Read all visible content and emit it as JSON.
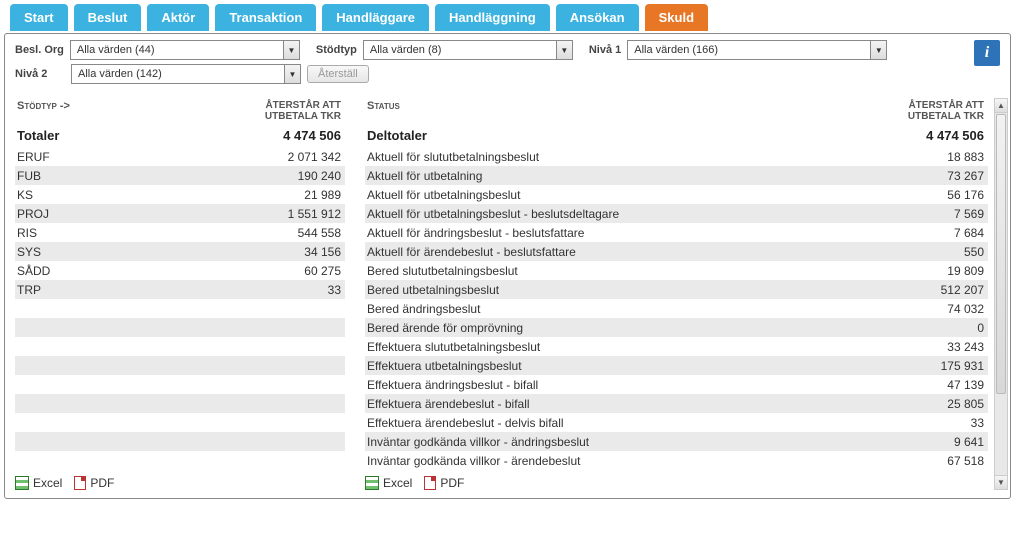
{
  "tabs": [
    "Start",
    "Beslut",
    "Aktör",
    "Transaktion",
    "Handläggare",
    "Handläggning",
    "Ansökan",
    "Skuld"
  ],
  "activeTab": "Skuld",
  "filters": {
    "beslOrgLabel": "Besl. Org",
    "beslOrgValue": "Alla värden (44)",
    "stodtypLabel": "Stödtyp",
    "stodtypValue": "Alla värden (8)",
    "niva1Label": "Nivå 1",
    "niva1Value": "Alla värden (166)",
    "niva2Label": "Nivå 2",
    "niva2Value": "Alla värden (142)",
    "resetLabel": "Återställ"
  },
  "left": {
    "header1": "Stödtyp ->",
    "header2a": "Återstår att",
    "header2b": "utbetala tkr",
    "totalLabel": "Totaler",
    "totalValue": "4 474 506",
    "rows": [
      {
        "label": "ERUF",
        "value": "2 071 342"
      },
      {
        "label": "FUB",
        "value": "190 240"
      },
      {
        "label": "KS",
        "value": "21 989"
      },
      {
        "label": "PROJ",
        "value": "1 551 912"
      },
      {
        "label": "RIS",
        "value": "544 558"
      },
      {
        "label": "SYS",
        "value": "34 156"
      },
      {
        "label": "SÅDD",
        "value": "60 275"
      },
      {
        "label": "TRP",
        "value": "33"
      },
      {
        "label": "",
        "value": ""
      },
      {
        "label": "",
        "value": ""
      },
      {
        "label": "",
        "value": ""
      },
      {
        "label": "",
        "value": ""
      },
      {
        "label": "",
        "value": ""
      },
      {
        "label": "",
        "value": ""
      },
      {
        "label": "",
        "value": ""
      },
      {
        "label": "",
        "value": ""
      },
      {
        "label": "",
        "value": ""
      }
    ]
  },
  "right": {
    "header1": "Status",
    "header2a": "Återstår att",
    "header2b": "utbetala tkr",
    "totalLabel": "Deltotaler",
    "totalValue": "4 474 506",
    "rows": [
      {
        "label": "Aktuell för slututbetalningsbeslut",
        "value": "18 883"
      },
      {
        "label": "Aktuell för utbetalning",
        "value": "73 267"
      },
      {
        "label": "Aktuell för utbetalningsbeslut",
        "value": "56 176"
      },
      {
        "label": "Aktuell för utbetalningsbeslut - beslutsdeltagare",
        "value": "7 569"
      },
      {
        "label": "Aktuell för ändringsbeslut - beslutsfattare",
        "value": "7 684"
      },
      {
        "label": "Aktuell för ärendebeslut - beslutsfattare",
        "value": "550"
      },
      {
        "label": "Bered slututbetalningsbeslut",
        "value": "19 809"
      },
      {
        "label": "Bered utbetalningsbeslut",
        "value": "512 207"
      },
      {
        "label": "Bered ändringsbeslut",
        "value": "74 032"
      },
      {
        "label": "Bered ärende för omprövning",
        "value": "0"
      },
      {
        "label": "Effektuera slututbetalningsbeslut",
        "value": "33 243"
      },
      {
        "label": "Effektuera utbetalningsbeslut",
        "value": "175 931"
      },
      {
        "label": "Effektuera ändringsbeslut - bifall",
        "value": "47 139"
      },
      {
        "label": "Effektuera ärendebeslut - bifall",
        "value": "25 805"
      },
      {
        "label": "Effektuera ärendebeslut - delvis bifall",
        "value": "33"
      },
      {
        "label": "Inväntar godkända villkor - ändringsbeslut",
        "value": "9 641"
      },
      {
        "label": "Inväntar godkända villkor - ärendebeslut",
        "value": "67 518"
      }
    ]
  },
  "export": {
    "excel": "Excel",
    "pdf": "PDF"
  },
  "info": "i"
}
